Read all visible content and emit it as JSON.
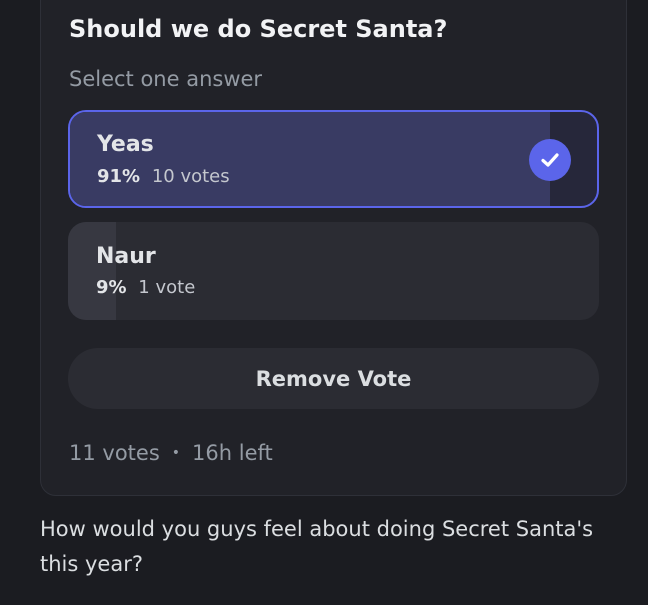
{
  "poll": {
    "question": "Should we do Secret Santa?",
    "instruction": "Select one answer",
    "answers": [
      {
        "label": "Yeas",
        "percent": "91%",
        "votes": "10 votes",
        "fraction": 0.91,
        "selected": true
      },
      {
        "label": "Naur",
        "percent": "9%",
        "votes": "1 vote",
        "fraction": 0.09,
        "selected": false
      }
    ],
    "remove_label": "Remove Vote",
    "total_votes": "11 votes",
    "separator": "•",
    "time_left": "16h left"
  },
  "message": {
    "text": "How would you guys feel about doing Secret Santa's this year?"
  },
  "colors": {
    "accent": "#5b65ea",
    "background": "#1b1c21",
    "card": "#212228"
  },
  "icons": {
    "selected": "check-icon"
  }
}
